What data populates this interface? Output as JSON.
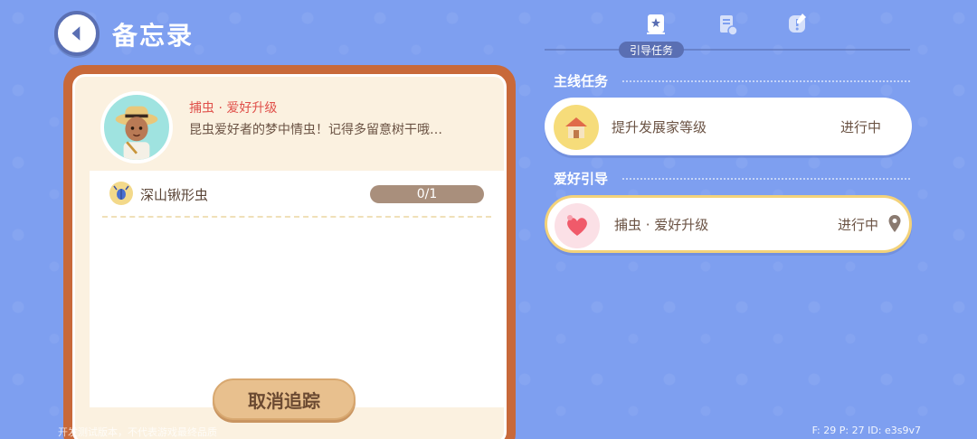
{
  "header": {
    "title": "备忘录",
    "back_icon": "back-arrow-icon"
  },
  "quest_detail": {
    "title": "捕虫 · 爱好升级",
    "description": "昆虫爱好者的梦中情虫！记得多留意树干哦…",
    "requirements": [
      {
        "name": "深山锹形虫",
        "progress": "0/1",
        "icon": "beetle-icon"
      }
    ],
    "cancel_label": "取消追踪"
  },
  "tabs": {
    "active_label": "引导任务",
    "icons": [
      "guide-book-icon",
      "clipboard-icon",
      "notebook-icon"
    ]
  },
  "sections": [
    {
      "label": "主线任务",
      "tasks": [
        {
          "name": "提升发展家等级",
          "status": "进行中",
          "icon": "house-icon"
        }
      ]
    },
    {
      "label": "爱好引导",
      "tasks": [
        {
          "name": "捕虫 · 爱好升级",
          "status": "进行中",
          "icon": "heart-icon",
          "tracked": true
        }
      ]
    }
  ],
  "footer": {
    "notice": "开发测试版本，不代表游戏最终品质",
    "stats": "F: 29    P: 27    ID: e3s9v7"
  },
  "colors": {
    "background": "#7e9ff0",
    "panel_border": "#c8693a",
    "accent_red": "#e0504a",
    "highlight": "#f3d27a"
  }
}
